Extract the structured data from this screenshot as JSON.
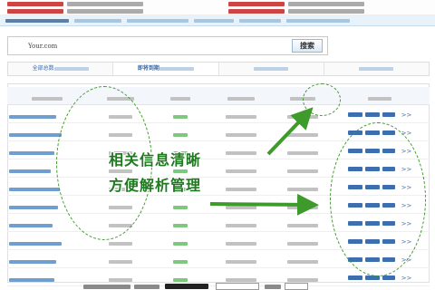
{
  "search": {
    "value": "Your.com",
    "button": "搜索"
  },
  "tabs": [
    {
      "label": "全部总数",
      "active": false
    },
    {
      "label": "即将到期",
      "active": true
    },
    {
      "label": "",
      "active": false
    },
    {
      "label": "",
      "active": false
    }
  ],
  "table": {
    "columns": [
      "",
      "",
      "",
      "",
      "",
      ""
    ],
    "rows": [
      {
        "domain": "",
        "registrar": "",
        "days": "",
        "reg_date": "",
        "exp_date": "",
        "action": ">>"
      },
      {
        "domain": "",
        "registrar": "",
        "days": "",
        "reg_date": "",
        "exp_date": "",
        "action": ">>"
      },
      {
        "domain": "",
        "registrar": "",
        "days": "",
        "reg_date": "",
        "exp_date": "",
        "action": ">>"
      },
      {
        "domain": "",
        "registrar": "",
        "days": "",
        "reg_date": "",
        "exp_date": "",
        "action": ">>"
      },
      {
        "domain": "",
        "registrar": "",
        "days": "",
        "reg_date": "",
        "exp_date": "",
        "action": ">>"
      },
      {
        "domain": "",
        "registrar": "",
        "days": "",
        "reg_date": "",
        "exp_date": "",
        "action": ">>"
      },
      {
        "domain": "",
        "registrar": "",
        "days": "",
        "reg_date": "",
        "exp_date": "",
        "action": ">>"
      },
      {
        "domain": "",
        "registrar": "",
        "days": "",
        "reg_date": "",
        "exp_date": "",
        "action": ">>"
      },
      {
        "domain": "",
        "registrar": "",
        "days": "",
        "reg_date": "",
        "exp_date": "",
        "action": ">>"
      },
      {
        "domain": "",
        "registrar": "",
        "days": "",
        "reg_date": "",
        "exp_date": "",
        "action": ">>"
      },
      {
        "domain": "",
        "registrar": "",
        "days": "",
        "reg_date": "",
        "exp_date": "",
        "action": ">>"
      }
    ]
  },
  "overlay": {
    "line1": "相关信息清晰",
    "line2": "方便解析管理"
  },
  "icons": {
    "highlight": "dashed-oval",
    "pointer": "green-arrow"
  },
  "colors": {
    "accent_green": "#3f9a2c",
    "link_blue": "#3d6fb0",
    "header_bg": "#f3f6fa"
  }
}
